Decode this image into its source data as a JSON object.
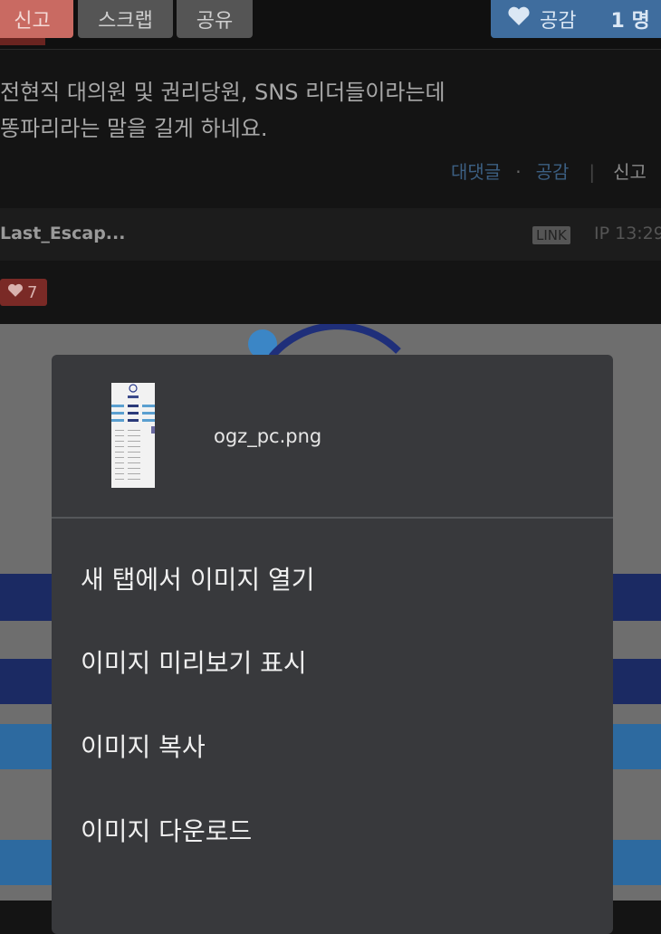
{
  "top_buttons": {
    "report": "신고",
    "scrap": "스크랩",
    "share": "공유",
    "like_label": "공감",
    "like_count": "1 명"
  },
  "comment": {
    "line1": "전현직 대의원 및 권리당원, SNS 리더들이라는데",
    "line2": "똥파리라는 말을 길게 하네요.",
    "actions": {
      "reply": "대댓글",
      "like": "공감",
      "report": "신고"
    }
  },
  "next_comment": {
    "username": "Last_Escap...",
    "link_badge": "LINK",
    "ip_time": "IP 13:29",
    "like_count": "7"
  },
  "context_menu": {
    "filename": "ogz_pc.png",
    "items": [
      "새 탭에서 이미지 열기",
      "이미지 미리보기 표시",
      "이미지 복사",
      "이미지 다운로드"
    ]
  },
  "colors": {
    "report_red": "#c96a62",
    "like_blue": "#3f6d9e",
    "menu_bg": "#38393c"
  }
}
